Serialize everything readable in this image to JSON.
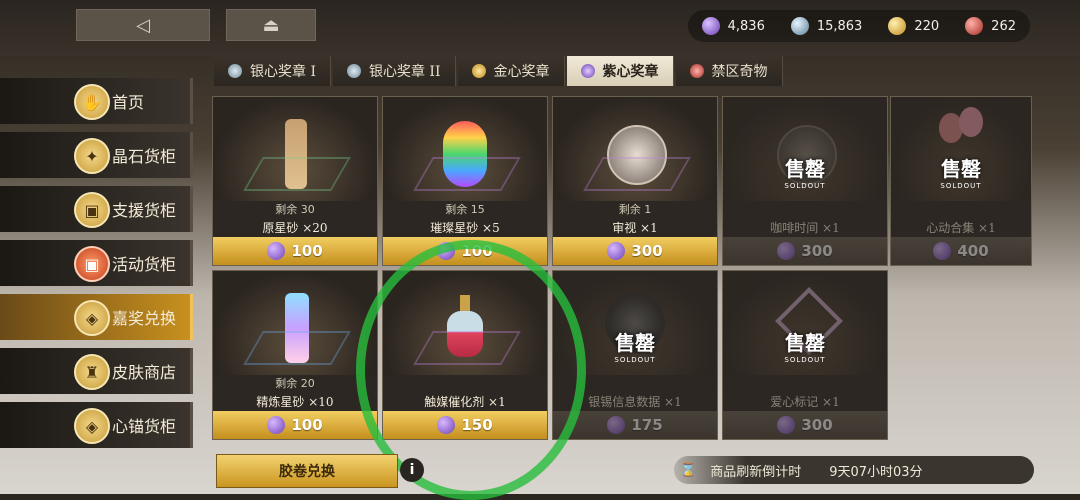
{
  "top": {
    "back_icon": "back-triangle-icon",
    "home_icon": "eject-icon"
  },
  "currencies": [
    {
      "icon": "purple-gem-icon",
      "value": "4,836",
      "color": "#8a5fd6"
    },
    {
      "icon": "silver-gem-icon",
      "value": "15,863",
      "color": "#8fb3c8"
    },
    {
      "icon": "gold-gem-icon",
      "value": "220",
      "color": "#e3b33c"
    },
    {
      "icon": "red-gem-icon",
      "value": "262",
      "color": "#c9443f"
    }
  ],
  "tabs": [
    {
      "label": "银心奖章 I",
      "icon": "silver-badge-icon"
    },
    {
      "label": "银心奖章 II",
      "icon": "silver-badge-icon"
    },
    {
      "label": "金心奖章",
      "icon": "gold-badge-icon"
    },
    {
      "label": "紫心奖章",
      "icon": "purple-badge-icon",
      "active": true
    },
    {
      "label": "禁区奇物",
      "icon": "red-badge-icon"
    }
  ],
  "sidebar": [
    {
      "label": "首页",
      "icon": "hand-icon"
    },
    {
      "label": "晶石货柜",
      "icon": "crystal-icon"
    },
    {
      "label": "支援货柜",
      "icon": "crate-icon"
    },
    {
      "label": "活动货柜",
      "icon": "event-crate-icon"
    },
    {
      "label": "嘉奖兑换",
      "icon": "diamond-badge-icon",
      "active": true
    },
    {
      "label": "皮肤商店",
      "icon": "outfit-icon"
    },
    {
      "label": "心锚货柜",
      "icon": "heart-anchor-icon"
    }
  ],
  "items": [
    {
      "name": "原星砂 ×20",
      "remain": "剩余 30",
      "price": "100",
      "sold": false,
      "art": "sand-bottle"
    },
    {
      "name": "璀璨星砂 ×5",
      "remain": "剩余 15",
      "price": "100",
      "sold": false,
      "art": "rainbow-bottle"
    },
    {
      "name": "审视 ×1",
      "remain": "剩余 1",
      "price": "300",
      "sold": false,
      "art": "portrait"
    },
    {
      "name": "咖啡时间 ×1",
      "remain": "",
      "price": "300",
      "sold": true,
      "art": "portrait"
    },
    {
      "name": "心动合集 ×1",
      "remain": "",
      "price": "400",
      "sold": true,
      "art": "balloons"
    },
    {
      "name": "精炼星砂 ×10",
      "remain": "剩余 20",
      "price": "100",
      "sold": false,
      "art": "crystal-bottle"
    },
    {
      "name": "触媒催化剂 ×1",
      "remain": "",
      "price": "150",
      "sold": false,
      "art": "perfume-bottle"
    },
    {
      "name": "银锡信息数据 ×1",
      "remain": "",
      "price": "175",
      "sold": true,
      "art": "record"
    },
    {
      "name": "爱心标记 ×1",
      "remain": "",
      "price": "300",
      "sold": true,
      "art": "heart"
    }
  ],
  "soldout": {
    "main": "售罄",
    "sub": "SOLDOUT"
  },
  "bottom": {
    "exchange_label": "胶卷兑换",
    "info_icon": "i",
    "refresh_label": "商品刷新倒计时",
    "refresh_time": "9天07小时03分"
  }
}
